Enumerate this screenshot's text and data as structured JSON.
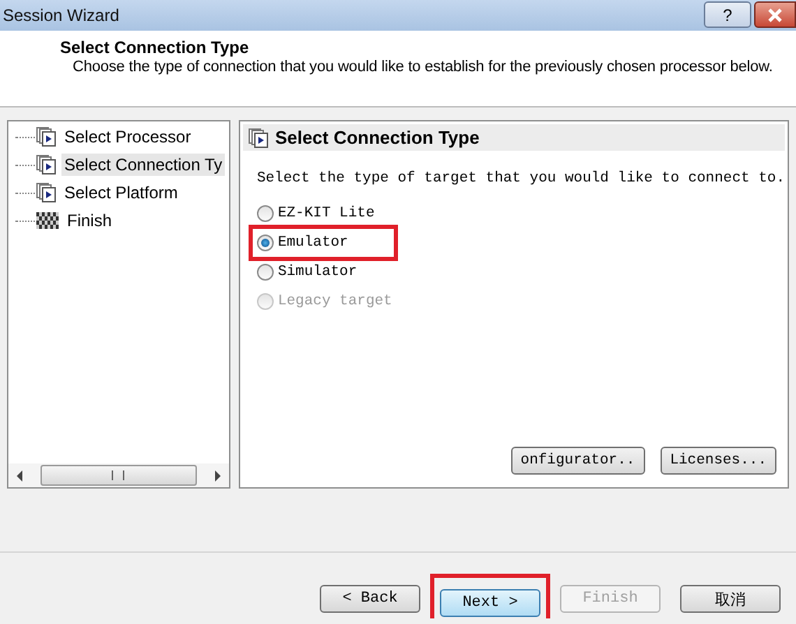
{
  "window": {
    "title": "Session Wizard",
    "help_button": "?"
  },
  "header": {
    "title": "Select Connection Type",
    "description": "Choose the type of connection that you would like to establish for the previously chosen processor below."
  },
  "tree": {
    "items": [
      {
        "label": "Select Processor",
        "kind": "page",
        "selected": false
      },
      {
        "label": "Select Connection Ty",
        "kind": "page",
        "selected": true
      },
      {
        "label": "Select Platform",
        "kind": "page",
        "selected": false
      },
      {
        "label": "Finish",
        "kind": "finish",
        "selected": false
      }
    ]
  },
  "panel": {
    "title": "Select Connection Type",
    "prompt": "Select the type of target that you would like to connect to.",
    "options": [
      {
        "label": "EZ-KIT Lite",
        "selected": false,
        "disabled": false,
        "highlighted": false
      },
      {
        "label": "Emulator",
        "selected": true,
        "disabled": false,
        "highlighted": true
      },
      {
        "label": "Simulator",
        "selected": false,
        "disabled": false,
        "highlighted": false
      },
      {
        "label": "Legacy target",
        "selected": false,
        "disabled": true,
        "highlighted": false
      }
    ],
    "buttons": [
      {
        "label": "onfigurator.."
      },
      {
        "label": "Licenses..."
      }
    ]
  },
  "footer": {
    "buttons": [
      {
        "label": "< Back",
        "disabled": false,
        "default": false,
        "highlighted": false
      },
      {
        "label": "Next >",
        "disabled": false,
        "default": true,
        "highlighted": true
      },
      {
        "label": "Finish",
        "disabled": true,
        "default": false,
        "highlighted": false
      },
      {
        "label": "取消",
        "disabled": false,
        "default": false,
        "highlighted": false
      }
    ]
  }
}
